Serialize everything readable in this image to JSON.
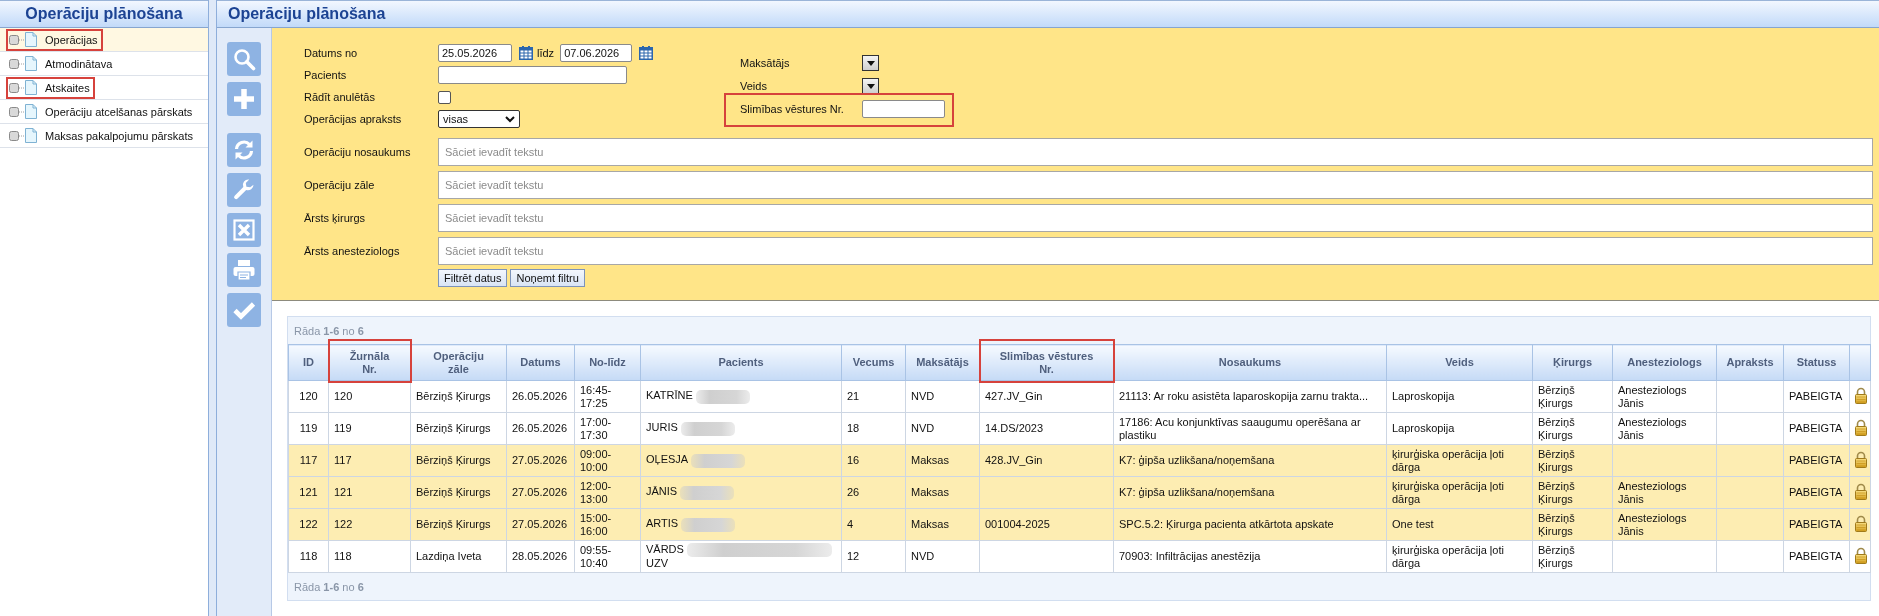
{
  "sidebar": {
    "title": "Operāciju plānošana",
    "items": [
      {
        "label": "Operācijas",
        "selected": true,
        "annotated": true
      },
      {
        "label": "Atmodinātava",
        "selected": false,
        "annotated": false
      },
      {
        "label": "Atskaites",
        "selected": false,
        "annotated": true
      },
      {
        "label": "Operāciju atcelšanas pārskats",
        "selected": false,
        "annotated": false
      },
      {
        "label": "Maksas pakalpojumu pārskats",
        "selected": false,
        "annotated": false
      }
    ]
  },
  "main": {
    "title": "Operāciju plānošana"
  },
  "filters": {
    "date_from": {
      "label": "Datums no",
      "value": "25.05.2026"
    },
    "date_to": {
      "label": "līdz",
      "value": "07.06.2026"
    },
    "patient": {
      "label": "Pacients"
    },
    "show_cancelled": {
      "label": "Rādīt anulētās",
      "checked": false
    },
    "description": {
      "label": "Operācijas apraksts",
      "value": "visas"
    },
    "payer": {
      "label": "Maksātājs"
    },
    "type": {
      "label": "Veids"
    },
    "history_no": {
      "label": "Slimības vēstures Nr.",
      "annotated": true
    },
    "text_filters": [
      {
        "label": "Operāciju nosaukums",
        "placeholder": "Sāciet ievadīt tekstu"
      },
      {
        "label": "Operāciju zāle",
        "placeholder": "Sāciet ievadīt tekstu"
      },
      {
        "label": "Ārsts ķirurgs",
        "placeholder": "Sāciet ievadīt tekstu"
      },
      {
        "label": "Ārsts anesteziologs",
        "placeholder": "Sāciet ievadīt tekstu"
      }
    ],
    "buttons": [
      "Filtrēt datus",
      "Noņemt filtru"
    ]
  },
  "grid": {
    "pager_top": "Rāda **1-6** no **6**",
    "columns": [
      {
        "label": "ID",
        "annotated": false
      },
      {
        "label": "Žurnāla Nr.",
        "annotated": true
      },
      {
        "label": "Operāciju zāle",
        "annotated": false
      },
      {
        "label": "Datums",
        "annotated": false
      },
      {
        "label": "No-līdz",
        "annotated": false
      },
      {
        "label": "Pacients",
        "annotated": false
      },
      {
        "label": "Vecums",
        "annotated": false
      },
      {
        "label": "Maksātājs",
        "annotated": false
      },
      {
        "label": "Slimības vēstures Nr.",
        "annotated": true
      },
      {
        "label": "Nosaukums",
        "annotated": false
      },
      {
        "label": "Veids",
        "annotated": false
      },
      {
        "label": "Ķirurgs",
        "annotated": false
      },
      {
        "label": "Anesteziologs",
        "annotated": false
      },
      {
        "label": "Apraksts",
        "annotated": false
      },
      {
        "label": "Statuss",
        "annotated": false
      }
    ],
    "rows": [
      {
        "id": "120",
        "journal_no": "120",
        "room": "Bērziņš Ķirurgs",
        "date": "26.05.2026",
        "time": "16:45-17:25",
        "patient": {
          "name": "KATRĪNE",
          "blurred": true,
          "blur_wide": false
        },
        "age": "21",
        "payer": "NVD",
        "history_no": "427.JV_Gin",
        "title": "21113: Ar roku asistēta laparoskopija zarnu trakta...",
        "type": "Laproskopija",
        "surgeon": "Bērziņš Ķirurgs",
        "anesthesiologist": "Anesteziologs Jānis",
        "status": "PABEIGTA",
        "locked": true,
        "highlighted": false
      },
      {
        "id": "119",
        "journal_no": "119",
        "room": "Bērziņš Ķirurgs",
        "date": "26.05.2026",
        "time": "17:00-17:30",
        "patient": {
          "name": "JURIS",
          "blurred": true,
          "blur_wide": false
        },
        "age": "18",
        "payer": "NVD",
        "history_no": "14.DS/2023",
        "title": "17186: Acu konjunktīvas saaugumu operēšana ar plastiku",
        "type": "Laproskopija",
        "surgeon": "Bērziņš Ķirurgs",
        "anesthesiologist": "Anesteziologs Jānis",
        "status": "PABEIGTA",
        "locked": true,
        "highlighted": false
      },
      {
        "id": "117",
        "journal_no": "117",
        "room": "Bērziņš Ķirurgs",
        "date": "27.05.2026",
        "time": "09:00-10:00",
        "patient": {
          "name": "OĻESJA",
          "blurred": true,
          "blur_wide": false
        },
        "age": "16",
        "payer": "Maksas",
        "history_no": "428.JV_Gin",
        "title": "K7: ģipša uzlikšana/noņemšana",
        "type": "ķirurģiska operācija ļoti dārga",
        "surgeon": "Bērziņš Ķirurgs",
        "status": "PABEIGTA",
        "locked": true,
        "highlighted": true
      },
      {
        "id": "121",
        "journal_no": "121",
        "room": "Bērziņš Ķirurgs",
        "date": "27.05.2026",
        "time": "12:00-13:00",
        "patient": {
          "name": "JĀNIS",
          "blurred": true,
          "blur_wide": false
        },
        "age": "26",
        "payer": "Maksas",
        "title": "K7: ģipša uzlikšana/noņemšana",
        "type": "ķirurģiska operācija ļoti dārga",
        "surgeon": "Bērziņš Ķirurgs",
        "anesthesiologist": "Anesteziologs Jānis",
        "status": "PABEIGTA",
        "locked": true,
        "highlighted": true
      },
      {
        "id": "122",
        "journal_no": "122",
        "room": "Bērziņš Ķirurgs",
        "date": "27.05.2026",
        "time": "15:00-16:00",
        "patient": {
          "name": "ARTIS",
          "blurred": true,
          "blur_wide": false
        },
        "age": "4",
        "payer": "Maksas",
        "history_no": "001004-2025",
        "title": "SPC.5.2: Ķirurga pacienta atkārtota apskate",
        "type": "One test",
        "surgeon": "Bērziņš Ķirurgs",
        "anesthesiologist": "Anesteziologs Jānis",
        "status": "PABEIGTA",
        "locked": true,
        "highlighted": true
      },
      {
        "id": "118",
        "journal_no": "118",
        "room": "Lazdiņa Iveta",
        "date": "28.05.2026",
        "time": "09:55-10:40",
        "patient": {
          "name": "VĀRDS",
          "blurred": true,
          "blur_wide": true,
          "line_2": "UZV"
        },
        "age": "12",
        "payer": "NVD",
        "title": "70903: Infiltrācijas anestēzija",
        "type": "ķirurģiska operācija ļoti dārga",
        "surgeon": "Bērziņš Ķirurgs",
        "status": "PABEIGTA",
        "locked": true,
        "highlighted": false
      }
    ],
    "pager_bottom": "Rāda **1-6** no **6**"
  }
}
